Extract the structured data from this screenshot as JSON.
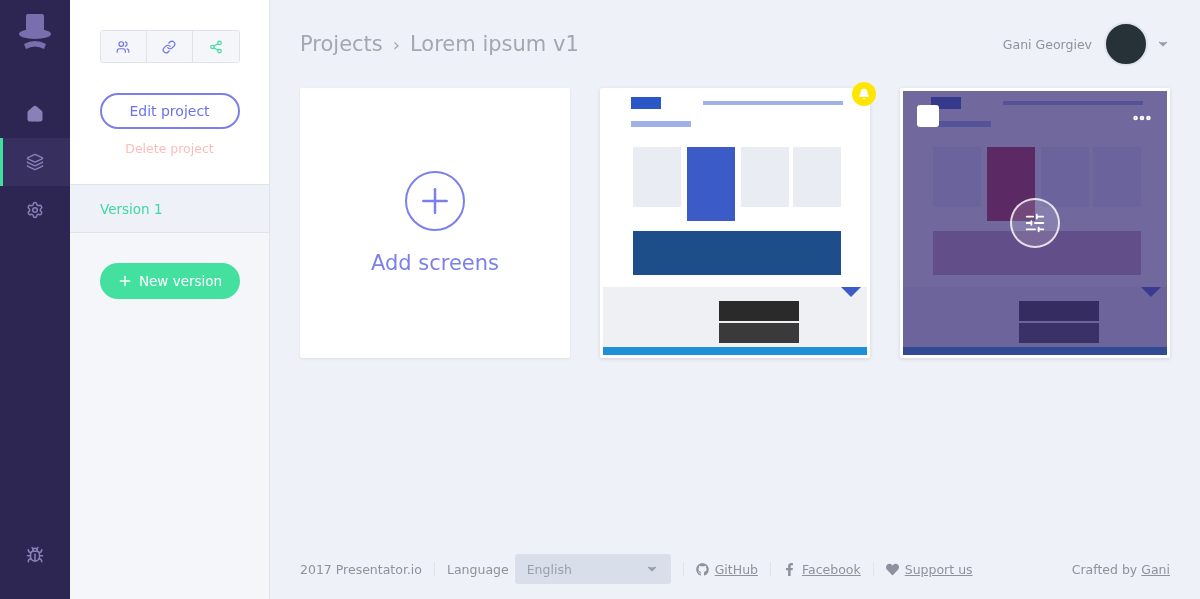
{
  "nav": {
    "items": [
      {
        "kind": "home",
        "selected": false
      },
      {
        "kind": "layers",
        "selected": true
      },
      {
        "kind": "settings",
        "selected": false
      }
    ]
  },
  "sidebar": {
    "tools": [
      {
        "kind": "users"
      },
      {
        "kind": "link"
      },
      {
        "kind": "share"
      }
    ],
    "edit_button": "Edit project",
    "delete_link": "Delete project",
    "versions": [
      {
        "label": "Version 1",
        "selected": true
      }
    ],
    "new_version_button": "New version"
  },
  "breadcrumb": {
    "root": "Projects",
    "separator": "›",
    "current": "Lorem ipsum v1"
  },
  "user": {
    "name": "Gani Georgiev"
  },
  "add_card": {
    "label": "Add screens"
  },
  "screens": [
    {
      "kind": "picture",
      "notification": true,
      "hovered": false,
      "checked": false
    },
    {
      "kind": "picture",
      "notification": false,
      "hovered": true,
      "checked": false
    }
  ],
  "footer": {
    "copyright": "2017 Presentator.io",
    "language_label": "Language",
    "language": "English",
    "links": [
      {
        "kind": "github",
        "label": "GitHub"
      },
      {
        "kind": "facebook",
        "label": "Facebook"
      },
      {
        "kind": "heart",
        "label": "Support us"
      }
    ],
    "credit": "Crafted by",
    "credit_link": "Gani"
  }
}
